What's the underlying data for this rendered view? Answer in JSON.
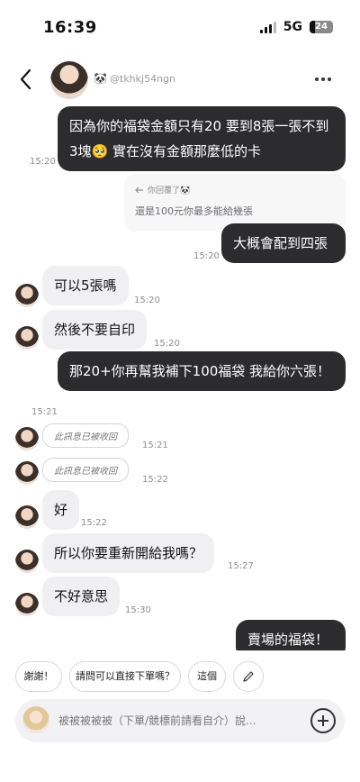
{
  "status_bar": {
    "time": "16:39",
    "network": "5G",
    "battery": "24",
    "battery_level": 0.24
  },
  "header": {
    "emoji": "🐼",
    "handle": "@tkhkj54ngn"
  },
  "messages": [
    {
      "text": "因為你的福袋金額只有20 要到8張一張不到3塊🥺 實在沒有金額那麼低的卡",
      "time": "15:20"
    },
    {
      "reply_label": "你回覆了🐼",
      "reply_quote": "還是100元你最多能給幾張"
    },
    {
      "text": "大概會配到四張",
      "time": "15:20"
    },
    {
      "text": "可以5張嗎",
      "time": "15:20"
    },
    {
      "text": "然後不要自印",
      "time": "15:20"
    },
    {
      "text": "那20+你再幫我補下100福袋 我給你六張！",
      "time": "15:21"
    },
    {
      "text": "此訊息已被收回",
      "time": "15:21"
    },
    {
      "text": "此訊息已被收回",
      "time": "15:22"
    },
    {
      "text": "好",
      "time": "15:22"
    },
    {
      "text": "所以你要重新開給我嗎？",
      "time": "15:27"
    },
    {
      "text": "不好意思",
      "time": "15:30"
    },
    {
      "text": "賣場的福袋！"
    }
  ],
  "quick_replies": [
    "謝謝！",
    "請問可以直接下單嗎？",
    "這個"
  ],
  "composer": {
    "placeholder": "被被被被被（下單/競標前請看自介）說..."
  }
}
